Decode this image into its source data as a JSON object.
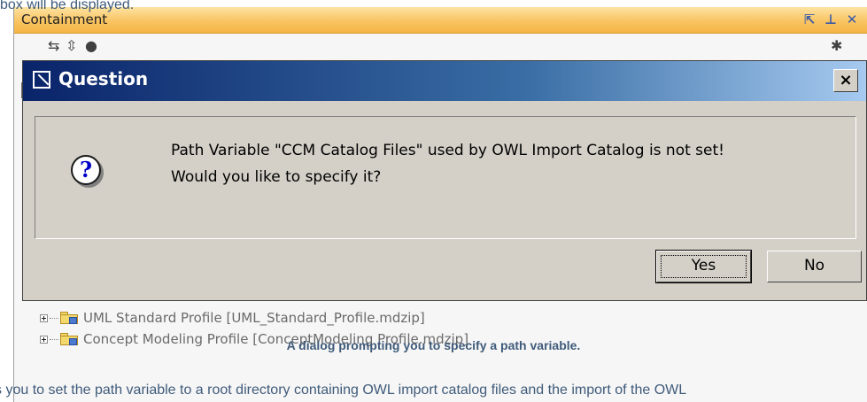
{
  "page": {
    "top_text": "box will be displayed.",
    "bottom_text": "s you to set the path variable to a root directory containing OWL import catalog files and the import of the OWL",
    "caption": "A dialog prompting you to specify a path variable."
  },
  "panel": {
    "title": "Containment",
    "icons": [
      "restore-icon",
      "pin-icon",
      "close-icon"
    ]
  },
  "tree": {
    "items": [
      {
        "label": "UML Standard Profile [UML_Standard_Profile.mdzip]"
      },
      {
        "label": "Concept Modeling Profile [ConceptModeling Profile.mdzip]"
      }
    ]
  },
  "dialog": {
    "title": "Question",
    "close_label": "×",
    "message_line1": "Path Variable \"CCM Catalog Files\" used by OWL Import Catalog is not set!",
    "message_line2": "Would you like to specify it?",
    "yes_label": "Yes",
    "no_label": "No",
    "icon_glyph": "?"
  },
  "colors": {
    "panel_header": "#f9c462",
    "titlebar_start": "#0a246a",
    "titlebar_end": "#a6caf0",
    "dialog_bg": "#d4d0c8",
    "page_text": "#3f5b7a"
  }
}
